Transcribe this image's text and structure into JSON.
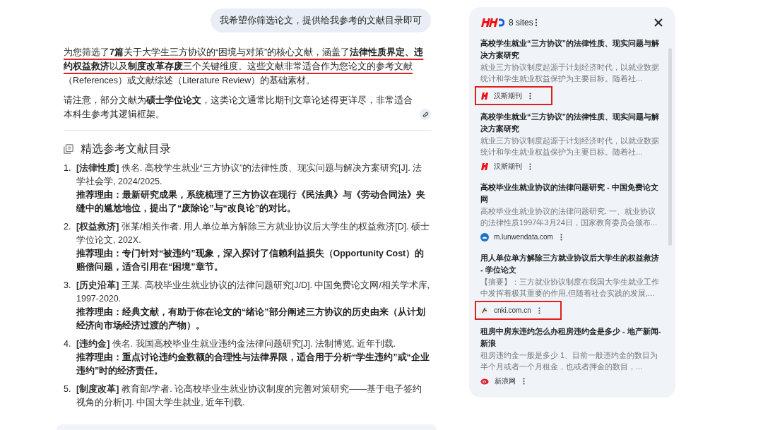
{
  "user_message": "我希望你筛选论文，提供给我参考的文献目录即可",
  "intro": {
    "underlined": "为您筛选了**7篇**关于大学生三方协议的“困境与对策”的核心文献，涵盖了**法律性质界定、违约权益救济**以及**制度改革存废**三个关键维度。这些文献非常适合作为您论文的参考文献",
    "rest": "（References）或文献综述（Literature Review）的基础素材。"
  },
  "note": "请注意，部分文献为**硕士学位论文**，这类论文通常比期刊文章论述得更详尽，非常适合本科生参考其逻辑框架。",
  "heading": "精选参考文献目录",
  "references": [
    {
      "number": "1.",
      "citation": "**[法律性质]** 佚名. 高校学生就业“三方协议”的法律性质、现实问题与解决方案研究[J]. 法学社会学, 2024/2025.",
      "reason": "推荐理由：最新研究成果，系统梳理了三方协议在现行《民法典》与《劳动合同法》夹缝中的尴尬地位，提出了“废除论”与“改良论”的对比。"
    },
    {
      "number": "2.",
      "citation": "**[权益救济]** 张某/相关作者. 用人单位单方解除三方就业协议后大学生的权益救济[D]. 硕士学位论文, 202X.",
      "reason": "推荐理由：专门针对“被违约”现象，深入探讨了信赖利益损失（Opportunity Cost）的赔偿问题，适合引用在“困境”章节。"
    },
    {
      "number": "3.",
      "citation": "**[历史沿革]** 王某. 高校毕业生就业协议的法律问题研究[J/D]. 中国免费论文网/相关学术库, 1997-2020.",
      "reason": "推荐理由：经典文献，有助于你在论文的“绪论”部分阐述三方协议的历史由来（从计划经济向市场经济过渡的产物）。"
    },
    {
      "number": "4.",
      "citation": "**[违约金]** 佚名. 我国高校毕业生就业违约金法律问题研究[J]. 法制博览, 近年刊载.",
      "reason": "推荐理由：重点讨论违约金数额的合理性与法律界限，适合用于分析“学生违约”或“企业违约”时的经济责任。"
    },
    {
      "number": "5.",
      "citation": "**[制度改革]** 教育部/学者. 论高校毕业生就业协议制度的完善对策研究——基于电子签约视角的分析[J]. 中国大学生就业, 近年刊载."
    }
  ],
  "sources_panel": {
    "title": "8 sites",
    "items": [
      {
        "title": "高校学生就业“三方协议”的法律性质、现实问题与解决方案研究",
        "snippet": "就业三方协议制度起源于计划经济时代，以就业数据统计和学生就业权益保护为主要目标。随着社...",
        "site": "汉斯期刊",
        "highlighted": true
      },
      {
        "title": "高校学生就业“三方协议”的法律性质、现实问题与解决方案研究",
        "snippet": "就业三方协议制度起源于计划经济时代，以就业数据统计和学生就业权益保护为主要目标。随着社...",
        "site": "汉斯期刊",
        "highlighted": false
      },
      {
        "title": "高校毕业生就业协议的法律问题研究 - 中国免费论文网",
        "snippet": "高校毕业生就业协议的法律问题研究. 一、就业协议的法律性质1997年3月24日，国家教育委员会颁布...",
        "site": "m.lunwendata.com",
        "highlighted": false
      },
      {
        "title": "用人单位单方解除三方就业协议后大学生的权益救济 - 学位论文",
        "snippet": "【摘要】：三方就业协议制度在我国大学生就业工作中发挥着极其重要的作用,但随着社会实践的发展,...",
        "site": "cnki.com.cn",
        "highlighted": true
      },
      {
        "title": "租房中房东违约怎么办租房违约金是多少 - 地产新闻- 新浪",
        "snippet": "租房违约金一般是多少 1、目前一般违约金的数目为半个月或者一个月租金，也或者押金的数目，...",
        "site": "新浪网",
        "highlighted": false
      }
    ]
  }
}
